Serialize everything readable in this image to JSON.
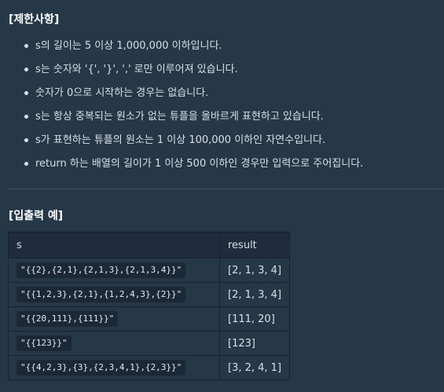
{
  "constraints_heading": "[제한사항]",
  "constraints": [
    "s의 길이는 5 이상 1,000,000 이하입니다.",
    "s는 숫자와 '{', '}', ',' 로만 이루어져 있습니다.",
    "숫자가 0으로 시작하는 경우는 없습니다.",
    "s는 항상 중복되는 원소가 없는 튜플을 올바르게 표현하고 있습니다.",
    "s가 표현하는 튜플의 원소는 1 이상 100,000 이하인 자연수입니다.",
    "return 하는 배열의 길이가 1 이상 500 이하인 경우만 입력으로 주어집니다."
  ],
  "io_heading": "[입출력 예]",
  "table": {
    "headers": [
      "s",
      "result"
    ],
    "rows": [
      {
        "s": "\"{{2},{2,1},{2,1,3},{2,1,3,4}}\"",
        "result": "[2, 1, 3, 4]"
      },
      {
        "s": "\"{{1,2,3},{2,1},{1,2,4,3},{2}}\"",
        "result": "[2, 1, 3, 4]"
      },
      {
        "s": "\"{{20,111},{111}}\"",
        "result": "[111, 20]"
      },
      {
        "s": "\"{{123}}\"",
        "result": "[123]"
      },
      {
        "s": "\"{{4,2,3},{3},{2,3,4,1},{2,3}}\"",
        "result": "[3, 2, 4, 1]"
      }
    ]
  }
}
